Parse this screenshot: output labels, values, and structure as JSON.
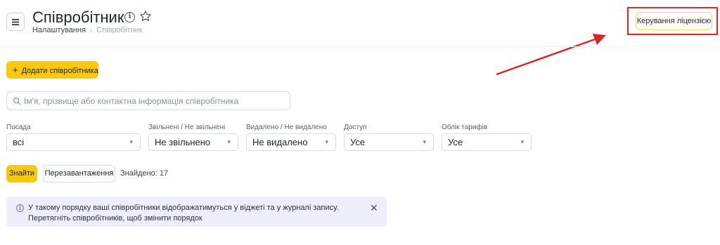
{
  "header": {
    "title": "Співробітник",
    "breadcrumb": {
      "parent": "Налаштування",
      "separator": "›",
      "current": "Співробітник"
    },
    "license_button": "Керування ліцензією"
  },
  "toolbar": {
    "add_employee": "Додати співробітника"
  },
  "search": {
    "placeholder": "Ім'я, прізвище або контактна інформація співробітника",
    "value": ""
  },
  "filters": [
    {
      "label": "Посада",
      "value": "всі"
    },
    {
      "label": "Звільнені / Не звільнені",
      "value": "Не звільнено"
    },
    {
      "label": "Видалено / Не видалено",
      "value": "Не видалено"
    },
    {
      "label": "Доступ",
      "value": "Усе"
    },
    {
      "label": "Облік тарифів",
      "value": "Усе"
    }
  ],
  "actions": {
    "find": "Знайти",
    "reload": "Перезавантаження",
    "found": "Знайдено: 17"
  },
  "notice": {
    "text": "У такому порядку ваші співробітники відображатимуться у віджеті та у журналі запису. Перетягніть співробітників, щоб змінити порядок"
  },
  "colors": {
    "accent": "#f8c90f",
    "highlight": "#d9262a",
    "notice_bg": "#eeeefa"
  },
  "icons": {
    "menu": "hamburger-icon",
    "info": "info-icon",
    "favorite": "star-icon",
    "search": "search-icon",
    "chevron": "chevron-down-icon",
    "close": "close-icon"
  }
}
